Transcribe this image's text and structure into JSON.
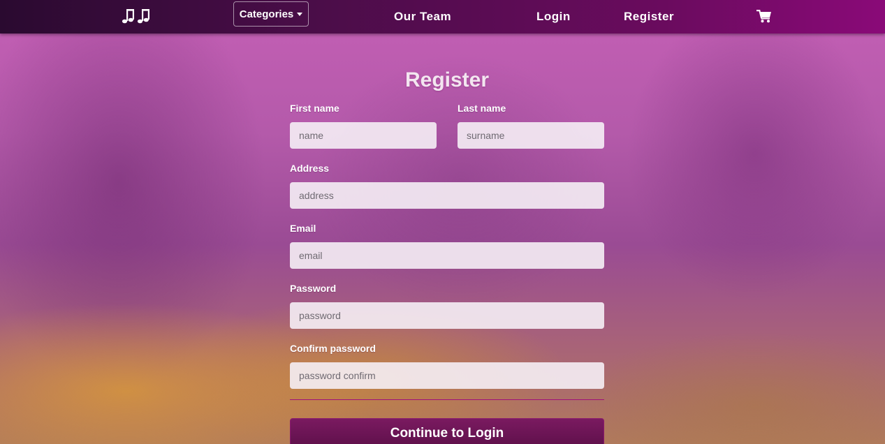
{
  "navbar": {
    "logo_icon": "music-notes-icon",
    "categories_label": "Categories",
    "links": [
      {
        "label": "Our Team"
      },
      {
        "label": "Login"
      },
      {
        "label": "Register"
      }
    ],
    "cart_icon": "shopping-cart-icon"
  },
  "form": {
    "title": "Register",
    "fields": {
      "first_name": {
        "label": "First name",
        "placeholder": "name"
      },
      "last_name": {
        "label": "Last name",
        "placeholder": "surname"
      },
      "address": {
        "label": "Address",
        "placeholder": "address"
      },
      "email": {
        "label": "Email",
        "placeholder": "email"
      },
      "password": {
        "label": "Password",
        "placeholder": "password"
      },
      "password_confirm": {
        "label": "Confirm password",
        "placeholder": "password confirm"
      }
    },
    "submit_label": "Continue to Login"
  },
  "colors": {
    "navbar_start": "#2a0a30",
    "navbar_end": "#8a0a78",
    "accent": "#a0107a",
    "button": "#6a1454"
  }
}
